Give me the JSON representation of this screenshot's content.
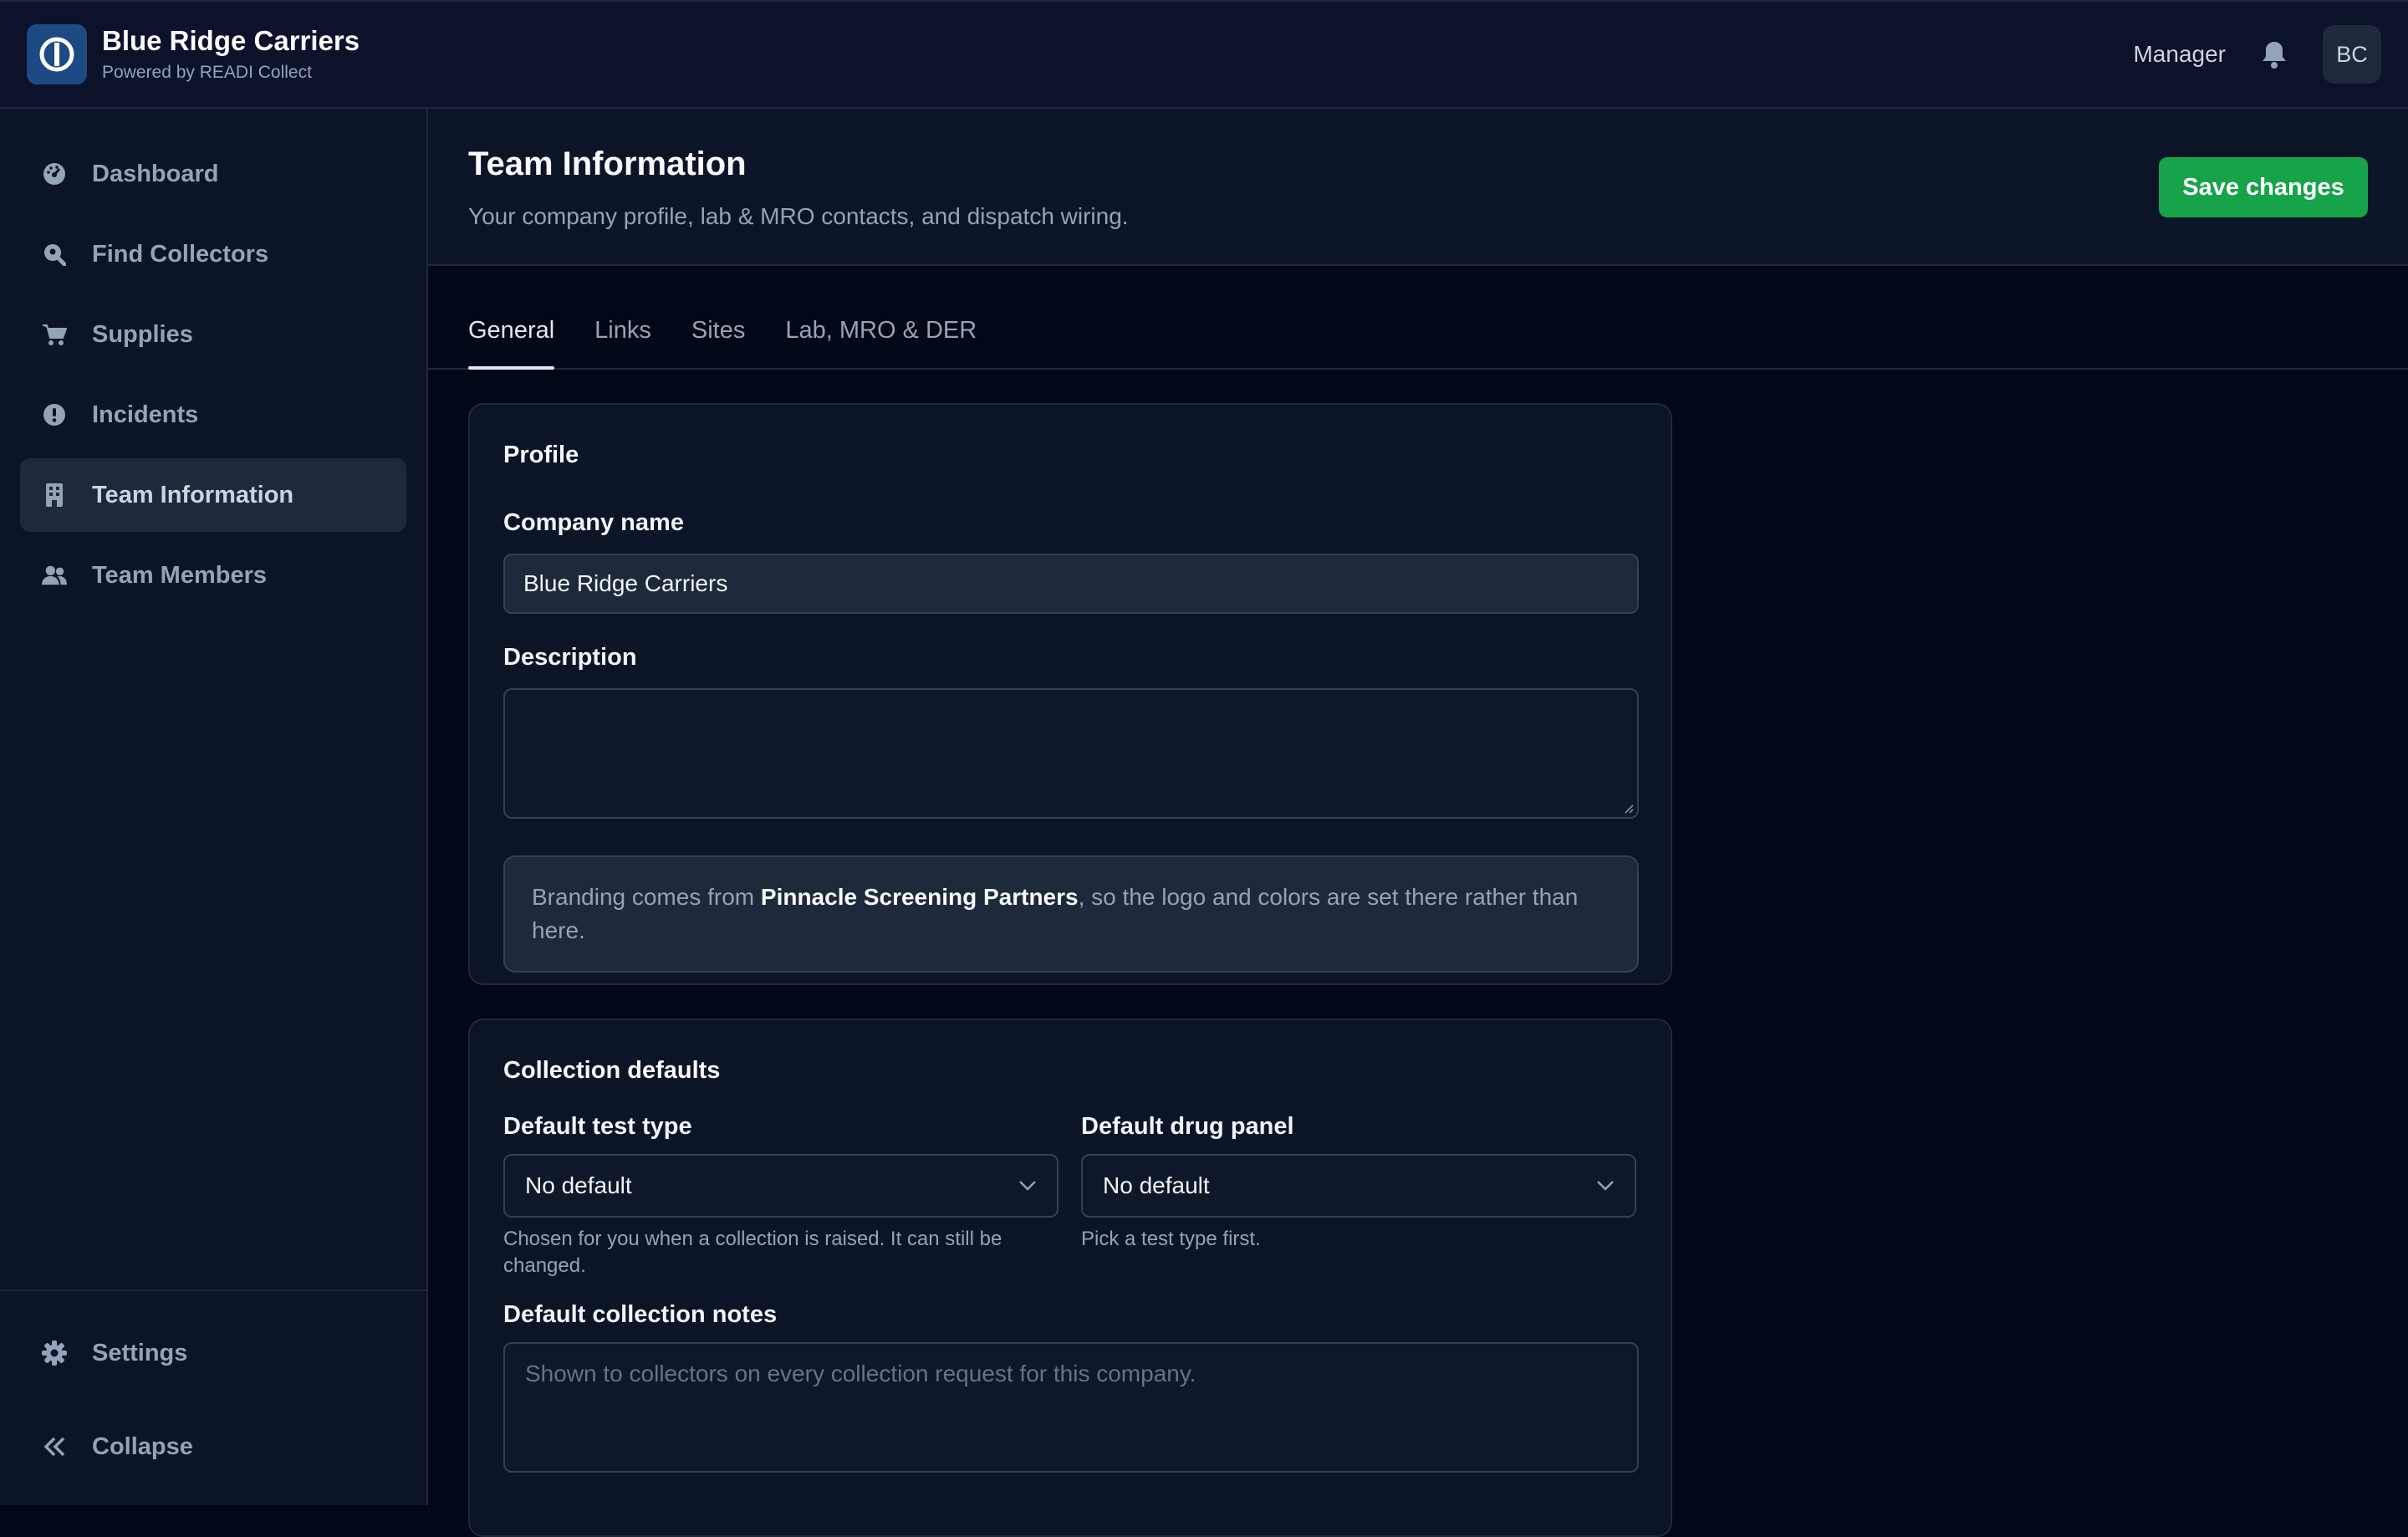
{
  "brand": {
    "name": "Blue Ridge Carriers",
    "subtitle": "Powered by READI Collect",
    "accent": "#1e4a84"
  },
  "topbar": {
    "role": "Manager",
    "avatar_initials": "BC"
  },
  "sidebar": {
    "items": [
      {
        "label": "Dashboard",
        "icon": "dashboard-gauge-icon",
        "active": false
      },
      {
        "label": "Find Collectors",
        "icon": "search-location-icon",
        "active": false
      },
      {
        "label": "Supplies",
        "icon": "cart-icon",
        "active": false
      },
      {
        "label": "Incidents",
        "icon": "alert-circle-icon",
        "active": false
      },
      {
        "label": "Team Information",
        "icon": "building-icon",
        "active": true
      },
      {
        "label": "Team Members",
        "icon": "users-icon",
        "active": false
      }
    ],
    "settings_label": "Settings",
    "collapse_label": "Collapse"
  },
  "page": {
    "title": "Team Information",
    "subtitle": "Your company profile, lab & MRO contacts, and dispatch wiring.",
    "save_label": "Save changes",
    "save_color": "#16a34a"
  },
  "tabs": [
    {
      "label": "General",
      "active": true
    },
    {
      "label": "Links",
      "active": false
    },
    {
      "label": "Sites",
      "active": false
    },
    {
      "label": "Lab, MRO & DER",
      "active": false
    }
  ],
  "profile": {
    "title": "Profile",
    "company_label": "Company name",
    "company_value": "Blue Ridge Carriers",
    "description_label": "Description",
    "description_value": "",
    "branding_prefix": "Branding comes from ",
    "branding_partner": "Pinnacle Screening Partners",
    "branding_suffix": ", so the logo and colors are set there rather than here."
  },
  "collection": {
    "title": "Collection defaults",
    "test_type_label": "Default test type",
    "test_type_value": "No default",
    "test_type_help": "Chosen for you when a collection is raised. It can still be changed.",
    "drug_panel_label": "Default drug panel",
    "drug_panel_value": "No default",
    "drug_panel_help": "Pick a test type first.",
    "notes_label": "Default collection notes",
    "notes_placeholder": "Shown to collectors on every collection request for this company."
  }
}
